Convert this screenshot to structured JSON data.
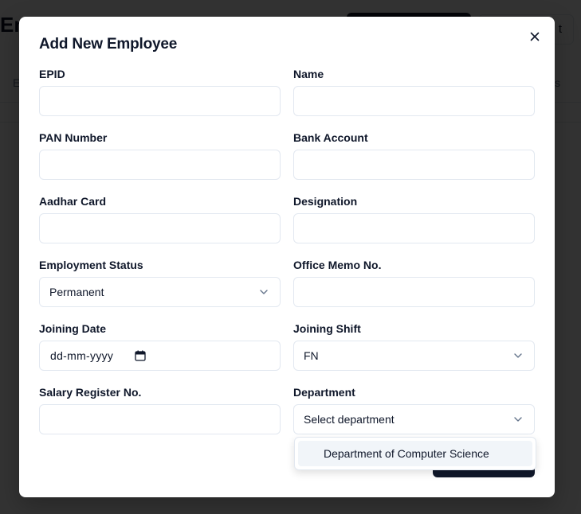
{
  "background": {
    "page_title": "Em",
    "outline_button_label": "t",
    "tab_left": "E",
    "tab_right": "s"
  },
  "modal": {
    "title": "Add New Employee",
    "fields": {
      "epid": {
        "label": "EPID",
        "value": ""
      },
      "name": {
        "label": "Name",
        "value": ""
      },
      "pan": {
        "label": "PAN Number",
        "value": ""
      },
      "bank": {
        "label": "Bank Account",
        "value": ""
      },
      "aadhar": {
        "label": "Aadhar Card",
        "value": ""
      },
      "designation": {
        "label": "Designation",
        "value": ""
      },
      "employment_status": {
        "label": "Employment Status",
        "value": "Permanent"
      },
      "office_memo": {
        "label": "Office Memo No.",
        "value": ""
      },
      "joining_date": {
        "label": "Joining Date",
        "value": "dd-mm-yyyy"
      },
      "joining_shift": {
        "label": "Joining Shift",
        "value": "FN"
      },
      "salary_register": {
        "label": "Salary Register No.",
        "value": ""
      },
      "department": {
        "label": "Department",
        "value": "Select department"
      }
    },
    "dropdown": {
      "options": [
        "Department of Computer Science"
      ]
    }
  },
  "icons": {
    "close": "close-icon",
    "chevron": "chevron-down-icon",
    "calendar": "calendar-icon"
  },
  "colors": {
    "primary": "#0f172a",
    "border": "#e2e8f0",
    "overlay": "rgba(0,0,0,0.8)",
    "highlight": "#f1f5f9"
  }
}
